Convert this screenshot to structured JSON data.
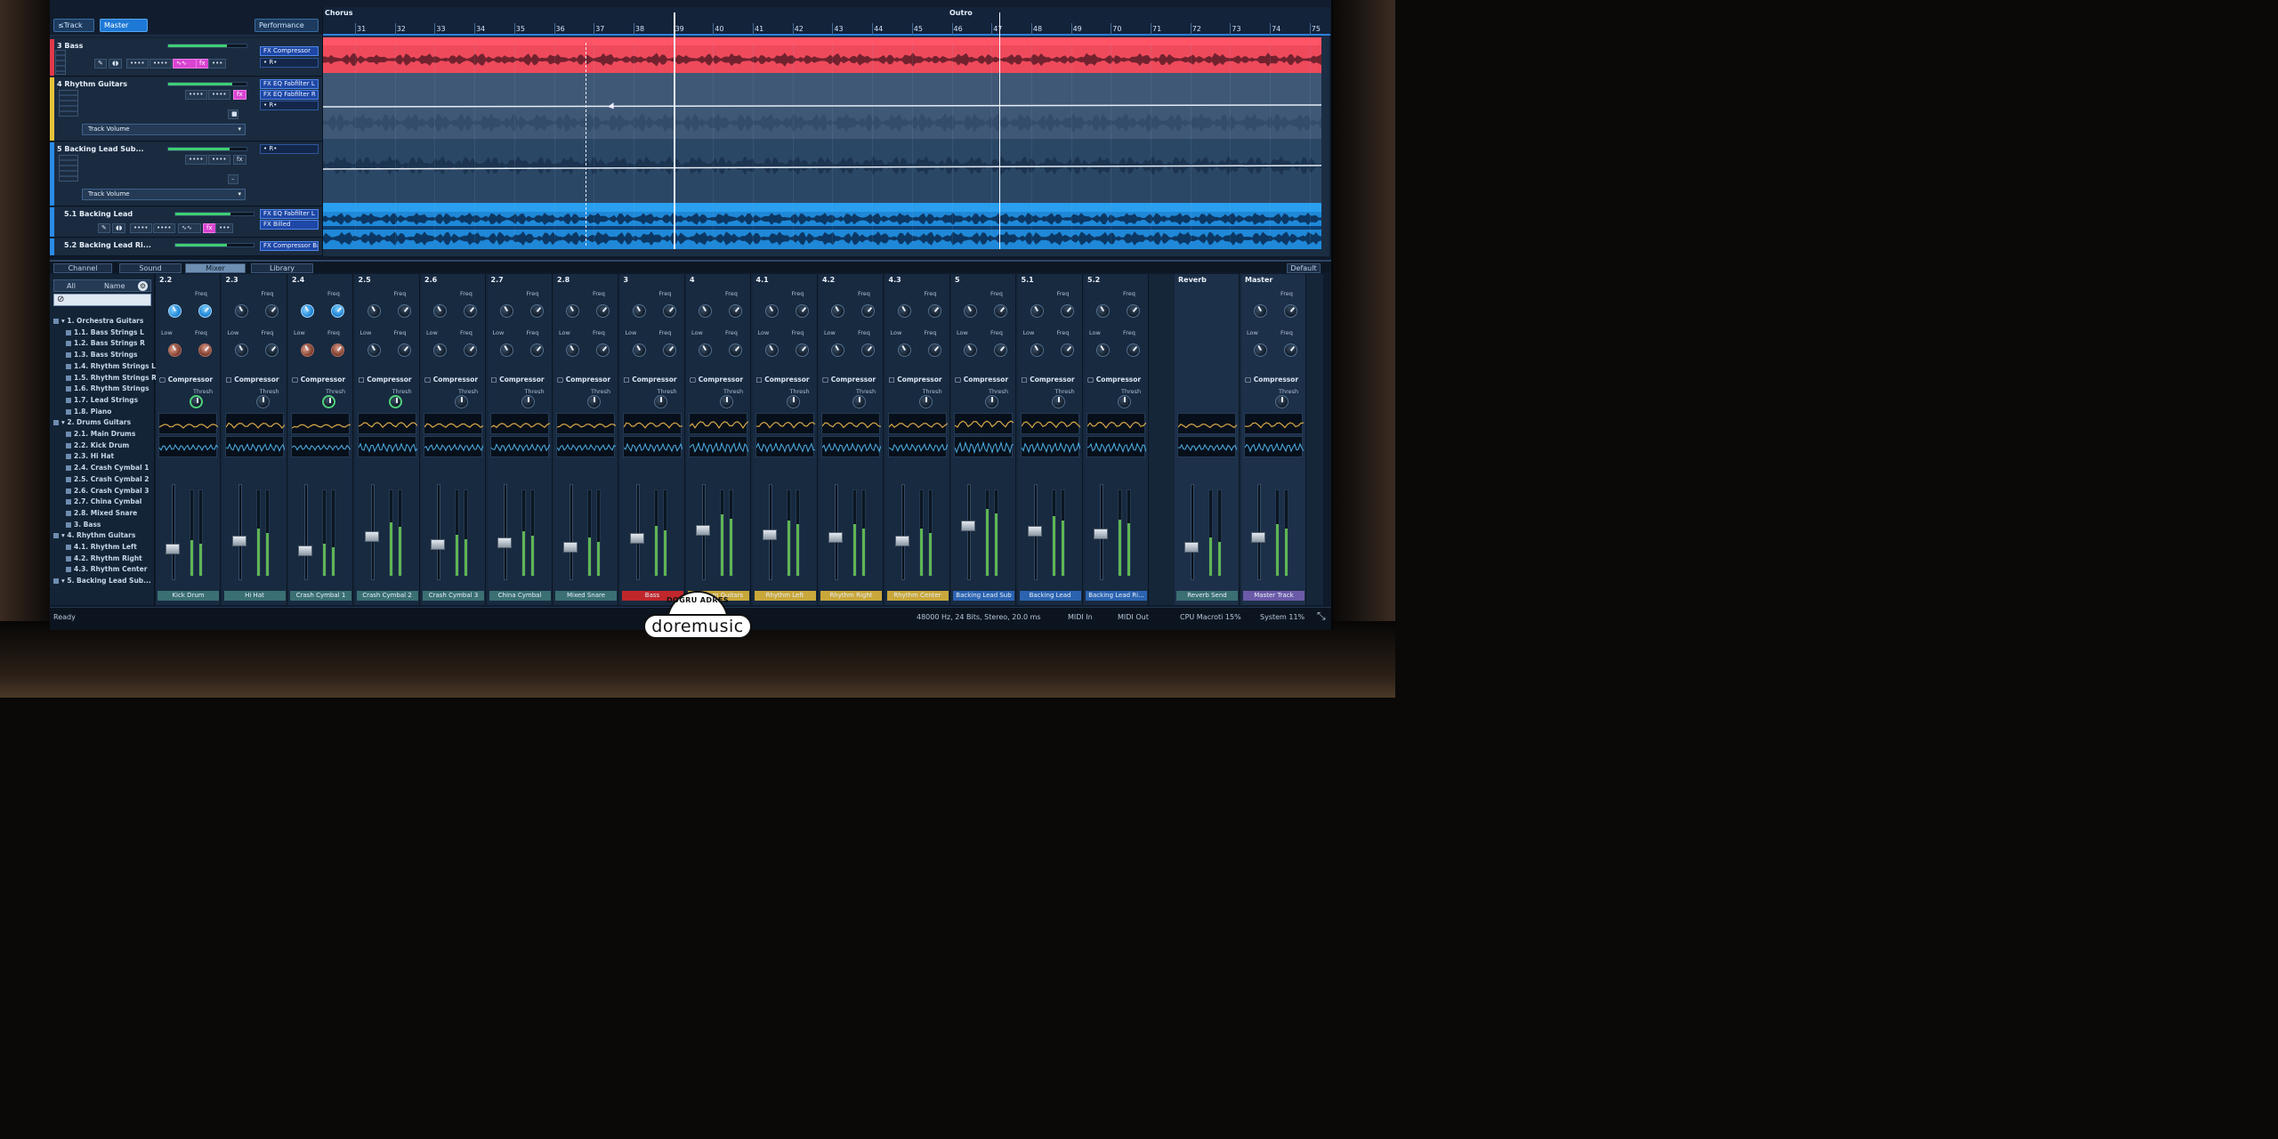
{
  "header": {
    "btn_track": "≤Track",
    "btn_master": "Master",
    "btn_performance": "Performance"
  },
  "ruler": {
    "section_a": "Chorus",
    "section_b": "Outro",
    "ticks": [
      "31",
      "32",
      "33",
      "34",
      "35",
      "36",
      "37",
      "38",
      "39",
      "40",
      "41",
      "42",
      "43",
      "44",
      "45",
      "46",
      "47",
      "48",
      "49",
      "70",
      "71",
      "72",
      "73",
      "74",
      "75"
    ]
  },
  "tracks": [
    {
      "name": "3 Bass",
      "color": "#e0394a",
      "insert": "FX Compressor",
      "insert2": "• R•",
      "buttons": [
        "••••",
        "••••",
        "fx",
        "•••"
      ]
    },
    {
      "name": "4 Rhythm Guitars",
      "color": "#e8c33a",
      "insert": "FX EQ Fabfilter L",
      "insert2": "FX EQ Fabfilter R",
      "insert3": "• R•",
      "buttons": [
        "••••",
        "••••",
        "fx"
      ],
      "selector": "Track Volume"
    },
    {
      "name": "5 Backing Lead Sub...",
      "color": "#2a8be8",
      "insert": "• R•",
      "buttons": [
        "••••",
        "••••",
        "fx"
      ],
      "selector": "Track Volume"
    },
    {
      "name": "5.1 Backing Lead",
      "color": "#2a8be8",
      "insert": "FX EQ Fabfilter L",
      "insert2": "FX Billed",
      "buttons": [
        "••••",
        "••••",
        "fx",
        "•••"
      ]
    },
    {
      "name": "5.2 Backing Lead Ri...",
      "color": "#2a8be8",
      "insert": "FX Compressor Ban",
      "buttons": []
    }
  ],
  "tabs": [
    "Channel",
    "Sound",
    "Mixer",
    "Library"
  ],
  "tabs_right": "Default",
  "browser": {
    "header_a": "All",
    "header_b": "Name",
    "items": [
      "▾ 1. Orchestra Guitars",
      "1.1. Bass Strings L",
      "1.2. Bass Strings R",
      "1.3. Bass Strings",
      "1.4. Rhythm Strings L",
      "1.5. Rhythm Strings R",
      "1.6. Rhythm Strings",
      "1.7. Lead Strings",
      "1.8. Piano",
      "▾ 2. Drums Guitars",
      "2.1. Main Drums",
      "2.2. Kick Drum",
      "2.3. Hi Hat",
      "2.4. Crash Cymbal 1",
      "2.5. Crash Cymbal 2",
      "2.6. Crash Cymbal 3",
      "2.7. China Cymbal",
      "2.8. Mixed Snare",
      "3. Bass",
      "▾ 4. Rhythm Guitars",
      "4.1. Rhythm Left",
      "4.2. Rhythm Right",
      "4.3. Rhythm Center",
      "▾ 5. Backing Lead Sub..."
    ]
  },
  "mixer": {
    "comp_label": "Compressor",
    "thresh": "Thresh",
    "freq": "Freq",
    "low": "Low",
    "channels": [
      {
        "no": "2.2",
        "label": "Kick Drum",
        "labelColor": "#3a6f73"
      },
      {
        "no": "2.3",
        "label": "Hi Hat",
        "labelColor": "#3a6f73"
      },
      {
        "no": "2.4",
        "label": "Crash Cymbal 1",
        "labelColor": "#3a6f73"
      },
      {
        "no": "2.5",
        "label": "Crash Cymbal 2",
        "labelColor": "#3a6f73"
      },
      {
        "no": "2.6",
        "label": "Crash Cymbal 3",
        "labelColor": "#3a6f73"
      },
      {
        "no": "2.7",
        "label": "China Cymbal",
        "labelColor": "#3a6f73"
      },
      {
        "no": "2.8",
        "label": "Mixed Snare",
        "labelColor": "#3a6f73"
      },
      {
        "no": "3",
        "label": "Bass",
        "labelColor": "#c0272d"
      },
      {
        "no": "4",
        "label": "Rhythm Guitars",
        "labelColor": "#c9a73a"
      },
      {
        "no": "4.1",
        "label": "Rhythm Left",
        "labelColor": "#c9a73a"
      },
      {
        "no": "4.2",
        "label": "Rhythm Right",
        "labelColor": "#c9a73a"
      },
      {
        "no": "4.3",
        "label": "Rhythm Center",
        "labelColor": "#c9a73a"
      },
      {
        "no": "5",
        "label": "Backing Lead Sub",
        "labelColor": "#2b63b0"
      },
      {
        "no": "5.1",
        "label": "Backing Lead",
        "labelColor": "#2b63b0"
      },
      {
        "no": "5.2",
        "label": "Backing Lead Ri...",
        "labelColor": "#2b63b0"
      }
    ],
    "reverb": {
      "no": "Reverb",
      "label": "Reverb Send",
      "labelColor": "#3a6f73"
    },
    "master": {
      "no": "Master",
      "label": "Master Track",
      "labelColor": "#6b5aa8"
    }
  },
  "status": {
    "ready": "Ready",
    "format": "48000 Hz, 24 Bits, Stereo, 20.0 ms",
    "midi_in": "MIDI In",
    "midi_out": "MIDI Out",
    "cpu": "CPU Macroti 15%",
    "system": "System 11%"
  },
  "logo": {
    "tagline": "DOĞRU ADRES",
    "name": "doremusic"
  }
}
